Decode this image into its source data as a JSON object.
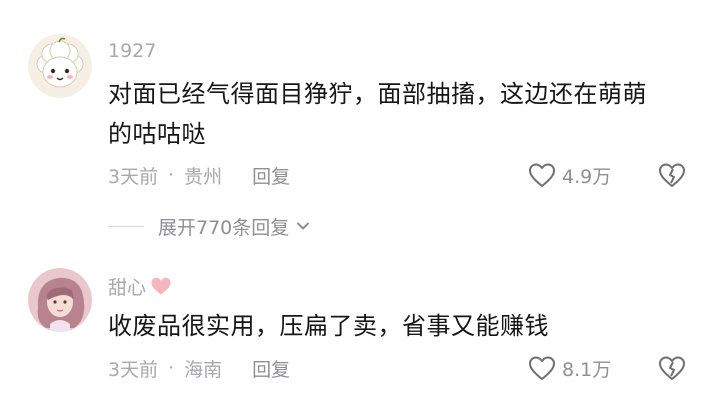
{
  "comments": [
    {
      "username": "1927",
      "text_line1": "对面已经气得面目狰狞，面部抽搐，这边还在萌萌",
      "text_line2": "的咕咕哒",
      "time": "3天前",
      "separator": "·",
      "location": "贵州",
      "reply_label": "回复",
      "likes": "4.9万"
    },
    {
      "username": "甜心",
      "text_line1": "收废品很实用，压扁了卖，省事又能赚钱",
      "time": "3天前",
      "separator": "·",
      "location": "海南",
      "reply_label": "回复",
      "likes": "8.1万"
    }
  ],
  "expand_replies": {
    "label": "展开770条回复"
  },
  "colors": {
    "meta_gray": "#a8a8ad",
    "text": "#161616",
    "badge_pink": "#f4b6bf"
  }
}
